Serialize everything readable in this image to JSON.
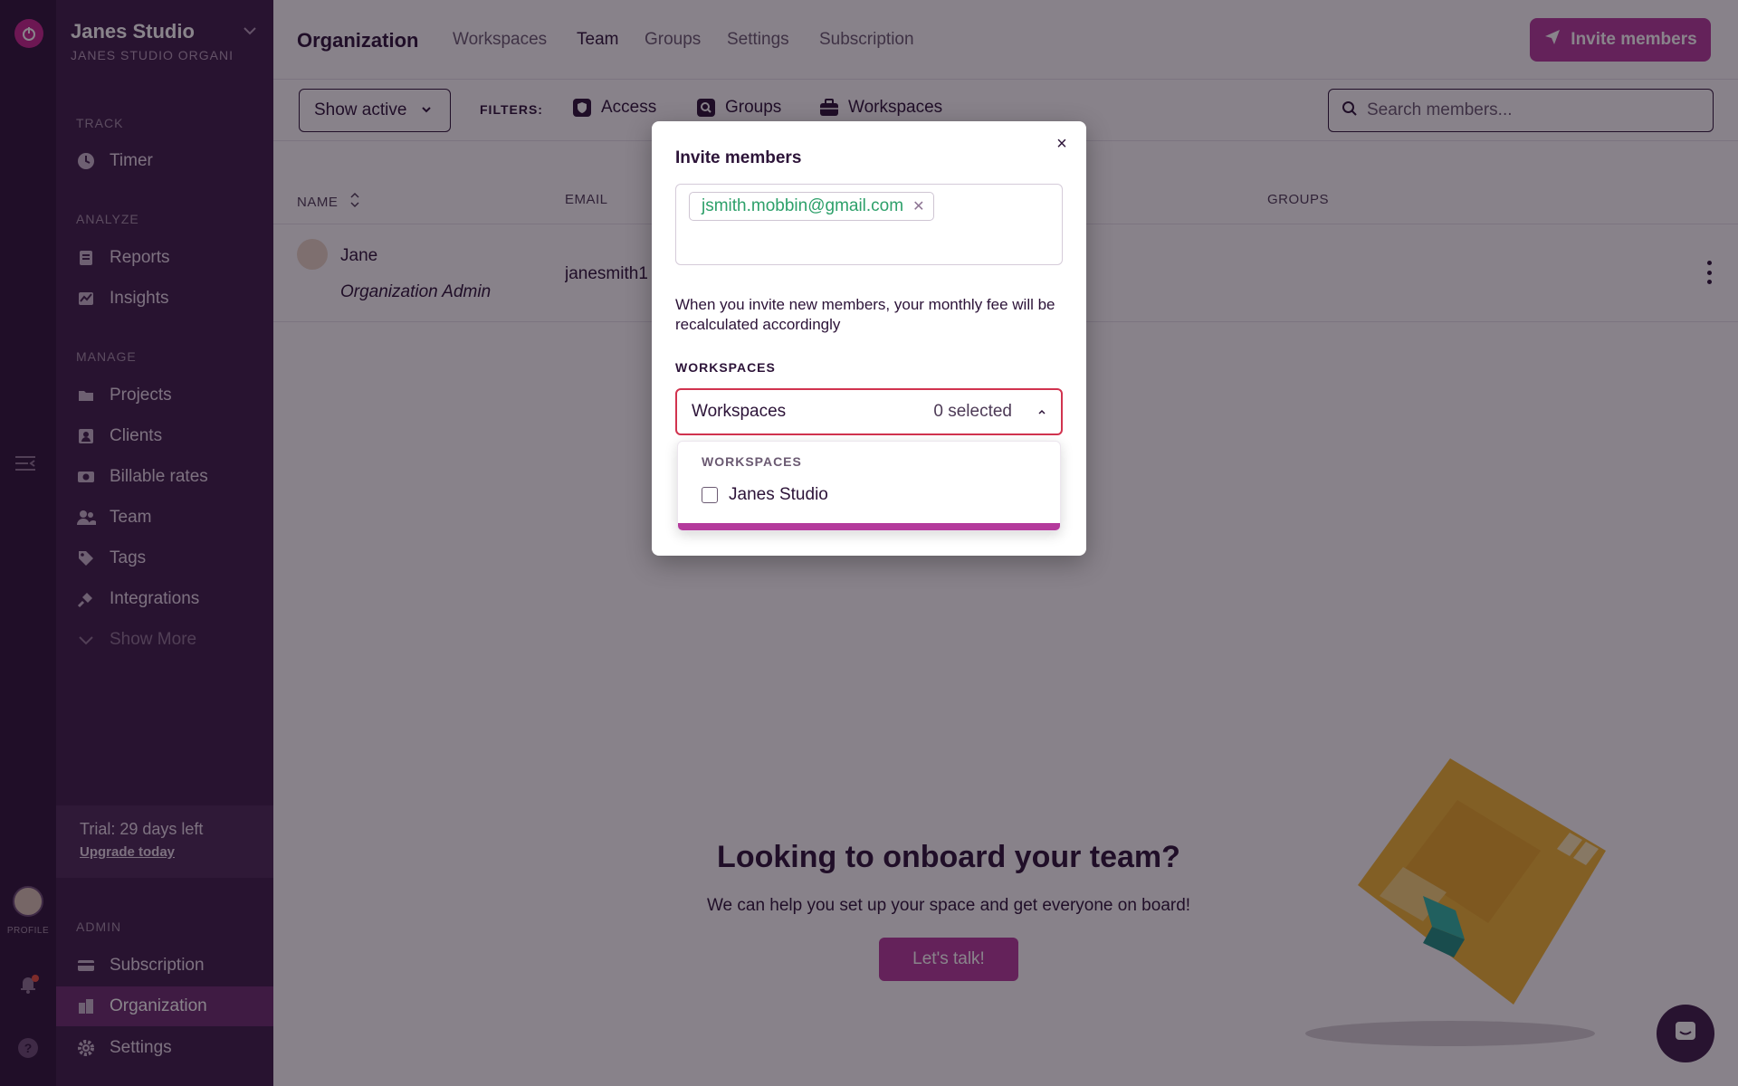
{
  "sidebar": {
    "org_name": "Janes Studio",
    "org_sub": "JANES STUDIO ORGANIZATION",
    "sections": {
      "track": "TRACK",
      "analyze": "ANALYZE",
      "manage": "MANAGE",
      "admin": "ADMIN"
    },
    "items": {
      "timer": "Timer",
      "reports": "Reports",
      "insights": "Insights",
      "projects": "Projects",
      "clients": "Clients",
      "billable_rates": "Billable rates",
      "team": "Team",
      "tags": "Tags",
      "integrations": "Integrations",
      "show_more": "Show More",
      "subscription": "Subscription",
      "organization": "Organization",
      "settings": "Settings"
    },
    "trial": {
      "text": "Trial: 29 days left",
      "link": "Upgrade today"
    },
    "profile_label": "PROFILE"
  },
  "header": {
    "title": "Organization",
    "tabs": [
      "Workspaces",
      "Team",
      "Groups",
      "Settings",
      "Subscription"
    ],
    "active_tab": "Team",
    "invite_button": "Invite members"
  },
  "filters": {
    "show_active": "Show active",
    "label": "FILTERS:",
    "access": "Access",
    "groups": "Groups",
    "workspaces": "Workspaces",
    "search_placeholder": "Search members..."
  },
  "table": {
    "columns": {
      "name": "NAME",
      "email": "EMAIL",
      "groups": "GROUPS"
    },
    "rows": [
      {
        "name": "Jane",
        "role": "Organization Admin",
        "email": "janesmith1"
      }
    ]
  },
  "onboard": {
    "title": "Looking to onboard your team?",
    "subtitle": "We can help you set up your space and get everyone on board!",
    "button": "Let's talk!"
  },
  "modal": {
    "title": "Invite members",
    "email_chip": "jsmith.mobbin@gmail.com",
    "note": "When you invite new members, your monthly fee will be recalculated accordingly",
    "workspaces_label": "WORKSPACES",
    "select_placeholder": "Workspaces",
    "selected_count": "0 selected",
    "dropdown_label": "WORKSPACES",
    "options": [
      "Janes Studio"
    ]
  },
  "colors": {
    "brand": "#b43a9c",
    "rail": "#2c1338",
    "sidebar": "#3d1d48",
    "error_border": "#d1334f",
    "chip_text": "#2da06a"
  }
}
